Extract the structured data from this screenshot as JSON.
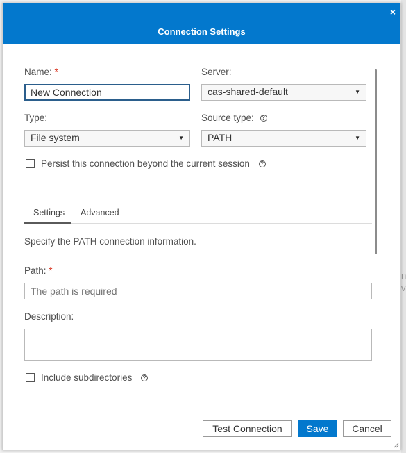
{
  "dialog": {
    "title": "Connection Settings",
    "close_glyph": "×"
  },
  "form": {
    "name_label": "Name:",
    "required_mark": "*",
    "name_value": "New Connection",
    "server_label": "Server:",
    "server_value": "cas-shared-default",
    "type_label": "Type:",
    "type_value": "File system",
    "source_type_label": "Source type:",
    "source_type_value": "PATH",
    "persist_label": "Persist this connection beyond the current session",
    "help_glyph": "?",
    "dropdown_glyph": "▼"
  },
  "tabs": [
    {
      "label": "Settings",
      "selected": true
    },
    {
      "label": "Advanced",
      "selected": false
    }
  ],
  "settings": {
    "instruction": "Specify the PATH connection information.",
    "path_label": "Path:",
    "path_placeholder": "The path is required",
    "description_label": "Description:",
    "include_subdirs_label": "Include subdirectories"
  },
  "footer": {
    "test_label": "Test Connection",
    "save_label": "Save",
    "cancel_label": "Cancel"
  },
  "backdrop": {
    "partial_text": "n\nv"
  },
  "colors": {
    "accent": "#0378cd",
    "required": "#d9331f"
  },
  "icons": {
    "close": "close-icon",
    "help": "help-icon",
    "dropdown": "chevron-down-icon",
    "resize": "resize-grip-icon"
  }
}
